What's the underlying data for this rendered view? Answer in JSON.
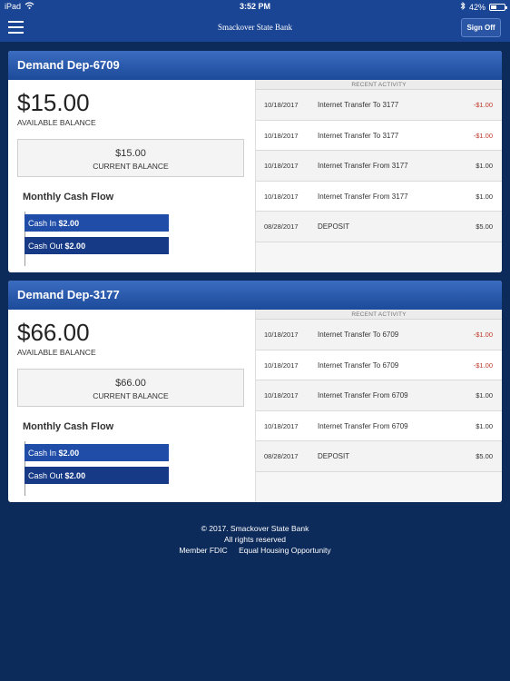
{
  "status_bar": {
    "device": "iPad",
    "time": "3:52 PM",
    "battery": "42%"
  },
  "nav": {
    "title": "Smackover State Bank",
    "sign_off": "Sign Off"
  },
  "accounts": [
    {
      "name": "Demand Dep-6709",
      "available_balance": "$15.00",
      "available_label": "AVAILABLE BALANCE",
      "current_balance": "$15.00",
      "current_label": "CURRENT BALANCE",
      "cash_flow_title": "Monthly Cash Flow",
      "cash_in_label": "Cash In",
      "cash_in_value": "$2.00",
      "cash_out_label": "Cash Out",
      "cash_out_value": "$2.00",
      "recent_activity_label": "RECENT ACTIVITY",
      "transactions": [
        {
          "date": "10/18/2017",
          "description": "Internet Transfer To 3177",
          "amount": "-$1.00"
        },
        {
          "date": "10/18/2017",
          "description": "Internet Transfer To 3177",
          "amount": "-$1.00"
        },
        {
          "date": "10/18/2017",
          "description": "Internet Transfer From 3177",
          "amount": "$1.00"
        },
        {
          "date": "10/18/2017",
          "description": "Internet Transfer From 3177",
          "amount": "$1.00"
        },
        {
          "date": "08/28/2017",
          "description": "DEPOSIT",
          "amount": "$5.00"
        }
      ]
    },
    {
      "name": "Demand Dep-3177",
      "available_balance": "$66.00",
      "available_label": "AVAILABLE BALANCE",
      "current_balance": "$66.00",
      "current_label": "CURRENT BALANCE",
      "cash_flow_title": "Monthly Cash Flow",
      "cash_in_label": "Cash In",
      "cash_in_value": "$2.00",
      "cash_out_label": "Cash Out",
      "cash_out_value": "$2.00",
      "recent_activity_label": "RECENT ACTIVITY",
      "transactions": [
        {
          "date": "10/18/2017",
          "description": "Internet Transfer To 6709",
          "amount": "-$1.00"
        },
        {
          "date": "10/18/2017",
          "description": "Internet Transfer To 6709",
          "amount": "-$1.00"
        },
        {
          "date": "10/18/2017",
          "description": "Internet Transfer From 6709",
          "amount": "$1.00"
        },
        {
          "date": "10/18/2017",
          "description": "Internet Transfer From 6709",
          "amount": "$1.00"
        },
        {
          "date": "08/28/2017",
          "description": "DEPOSIT",
          "amount": "$5.00"
        }
      ]
    }
  ],
  "footer": {
    "copyright": "© 2017. Smackover State Bank",
    "rights": "All rights reserved",
    "member_fdic": "Member FDIC",
    "equal_housing": "Equal Housing Opportunity"
  },
  "colors": {
    "background": "#0c2a5a",
    "nav": "#1a4494",
    "negative": "#c0392b"
  },
  "icons": {
    "menu": "hamburger-icon",
    "wifi": "wifi-icon",
    "bluetooth": "bluetooth-icon",
    "battery": "battery-icon"
  }
}
